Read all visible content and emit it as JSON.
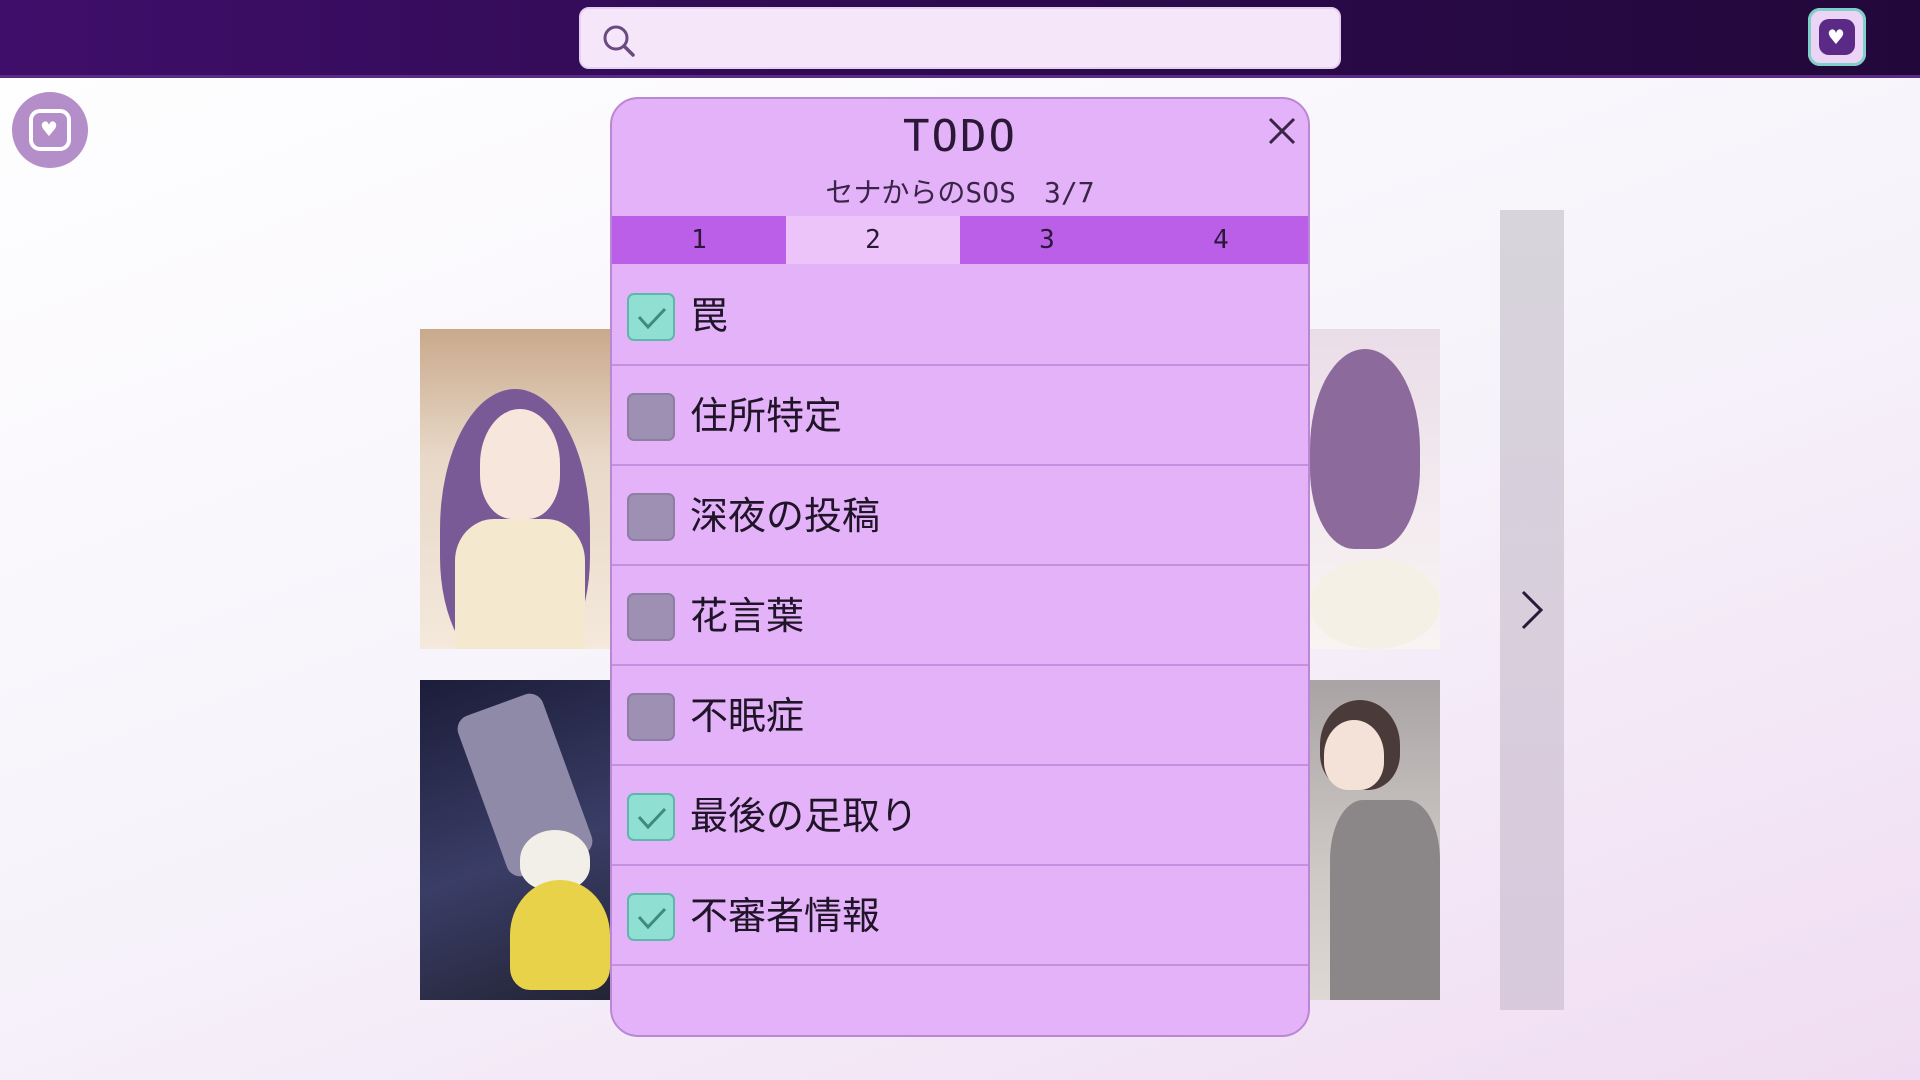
{
  "search": {
    "placeholder": "",
    "icon": "search-icon"
  },
  "colors": {
    "topbar": "#2d0a4e",
    "modal_bg": "#e4b2f8",
    "tab_bg": "#bb5fe9",
    "tab_active": "#ecc4fa",
    "checked": "#8fe0d3",
    "unchecked": "#9e90b2"
  },
  "modal": {
    "title": "TODO",
    "subtitle": "セナからのSOS　3/7",
    "close_icon": "close-icon",
    "tabs": [
      {
        "label": "1",
        "active": false
      },
      {
        "label": "2",
        "active": true
      },
      {
        "label": "3",
        "active": false
      },
      {
        "label": "4",
        "active": false
      }
    ],
    "items": [
      {
        "label": "罠",
        "checked": true
      },
      {
        "label": "住所特定",
        "checked": false
      },
      {
        "label": "深夜の投稿",
        "checked": false
      },
      {
        "label": "花言葉",
        "checked": false
      },
      {
        "label": "不眠症",
        "checked": false
      },
      {
        "label": "最後の足取り",
        "checked": true
      },
      {
        "label": "不審者情報",
        "checked": true
      }
    ]
  },
  "navigation": {
    "next_icon": "chevron-right-icon"
  }
}
